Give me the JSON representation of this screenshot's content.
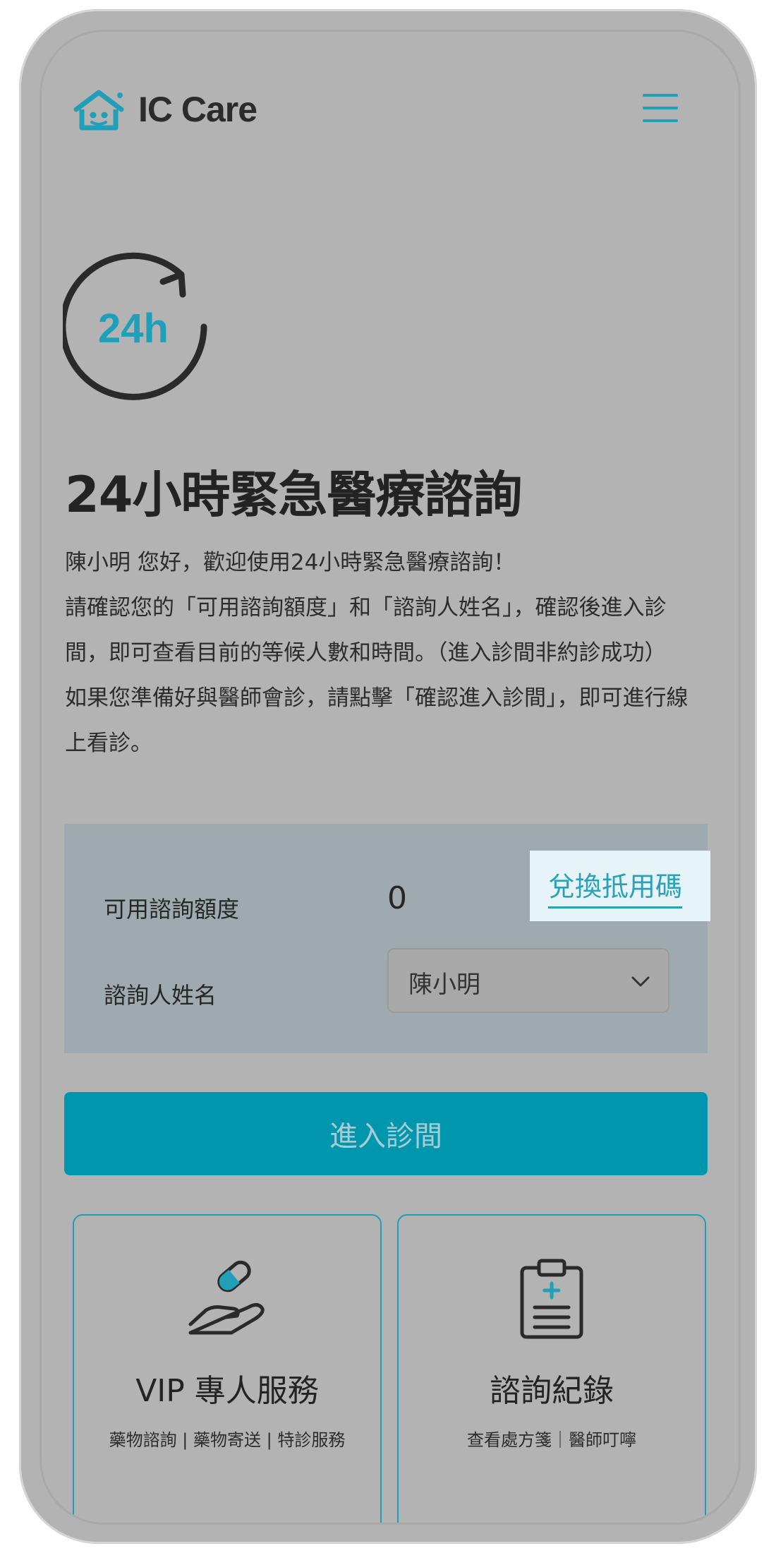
{
  "header": {
    "brand": "IC Care",
    "menu_icon": "hamburger-menu-icon"
  },
  "hero": {
    "clock_text": "24h",
    "title": "24小時緊急醫療諮詢",
    "intro": [
      "陳小明 您好，歡迎使用24小時緊急醫療諮詢！",
      "請確認您的「可用諮詢額度」和「諮詢人姓名」，確認後進入診間，即可查看目前的等候人數和時間。（進入診間非約診成功）",
      "如果您準備好與醫師會診，請點擊「確認進入診間」，即可進行線上看診。"
    ]
  },
  "form": {
    "quota_label": "可用諮詢額度",
    "quota_value": "0",
    "redeem_label": "兌換抵用碼",
    "name_label": "諮詢人姓名",
    "name_selected": "陳小明"
  },
  "actions": {
    "enter_label": "進入診間"
  },
  "cards": [
    {
      "title": "VIP 專人服務",
      "subtitle": "藥物諮詢 | 藥物寄送 | 特診服務",
      "icon": "pill-hand-icon"
    },
    {
      "title": "諮詢紀錄",
      "subtitle": "查看處方箋｜醫師叮嚀",
      "icon": "clipboard-icon"
    }
  ],
  "colors": {
    "accent": "#1f9fb8",
    "cta": "#0096ae",
    "overlay": "#b3b3b3"
  }
}
